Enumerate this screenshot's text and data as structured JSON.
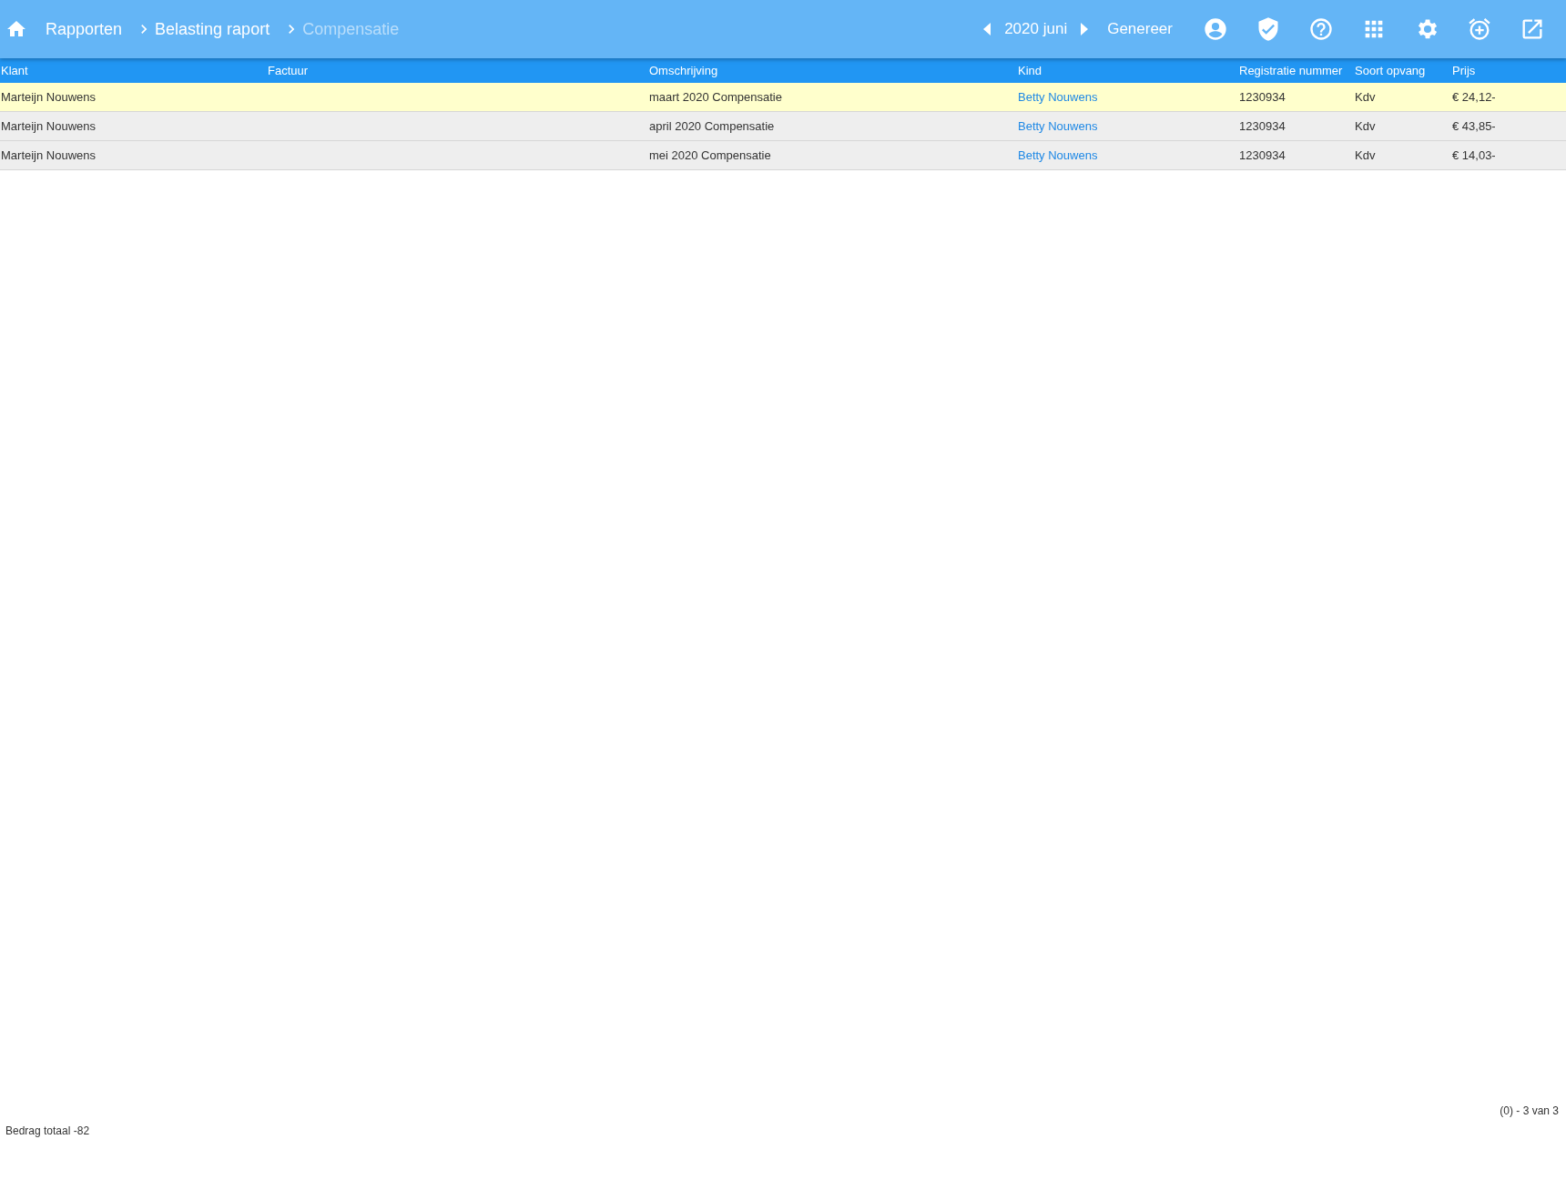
{
  "breadcrumb": [
    {
      "label": "Rapporten",
      "current": false
    },
    {
      "label": "Belasting raport",
      "current": false
    },
    {
      "label": "Compensatie",
      "current": true
    }
  ],
  "period": {
    "label": "2020 juni"
  },
  "generate_button": "Genereer",
  "table": {
    "columns": [
      "Klant",
      "Factuur",
      "Omschrijving",
      "Kind",
      "Registratie nummer",
      "Soort opvang",
      "Prijs"
    ],
    "rows": [
      {
        "selected": true,
        "cells": [
          "Marteijn Nouwens",
          "",
          "maart 2020 Compensatie",
          "Betty Nouwens",
          "1230934",
          "Kdv",
          "€ 24,12-"
        ]
      },
      {
        "selected": false,
        "cells": [
          "Marteijn Nouwens",
          "",
          "april 2020 Compensatie",
          "Betty Nouwens",
          "1230934",
          "Kdv",
          "€ 43,85-"
        ]
      },
      {
        "selected": false,
        "cells": [
          "Marteijn Nouwens",
          "",
          "mei 2020 Compensatie",
          "Betty Nouwens",
          "1230934",
          "Kdv",
          "€ 14,03-"
        ]
      }
    ]
  },
  "pagination": "(0) - 3 van 3",
  "total": "Bedrag totaal -82"
}
